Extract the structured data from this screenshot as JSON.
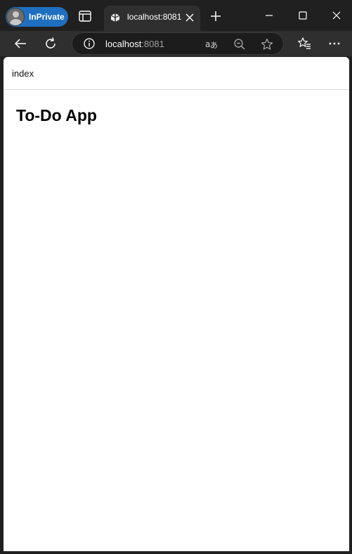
{
  "browser": {
    "profile_label": "InPrivate",
    "tab": {
      "title": "localhost:8081"
    },
    "address": {
      "host": "localhost",
      "port": ":8081"
    }
  },
  "page": {
    "nav_link": "index",
    "heading": "To-Do App"
  },
  "colors": {
    "chrome_dark": "#202020",
    "toolbar": "#2f2f2f",
    "inprivate_badge": "#1f6fc1",
    "page_background": "#ffffff"
  },
  "icons": {
    "tab_actions": "tab-actions-icon",
    "favicon": "favicon-icon",
    "tab_close": "close-icon",
    "new_tab": "plus-icon",
    "back": "back-arrow-icon",
    "refresh": "refresh-icon",
    "site_info": "info-icon",
    "read_aloud": "read-aloud-icon",
    "zoom_out": "zoom-out-icon",
    "favorite": "star-icon",
    "favorites_list": "favorites-icon",
    "more": "more-icon"
  }
}
